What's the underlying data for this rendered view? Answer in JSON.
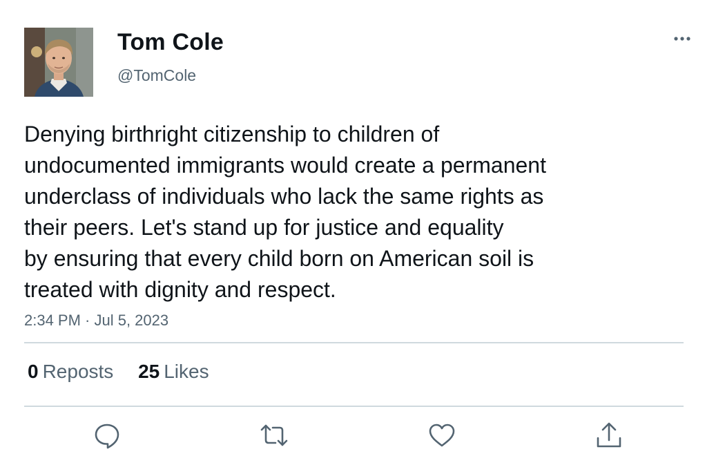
{
  "author": {
    "name": "Tom Cole",
    "handle": "@TomCole",
    "avatar_icon": "profile-photo"
  },
  "tweet": {
    "text": "Denying birthright citizenship to children of\nundocumented immigrants would create a permanent\nunderclass of individuals who lack the same rights as\ntheir peers. Let's stand up for justice and equality\nby ensuring that every child born on American soil is\ntreated with dignity and respect.",
    "timestamp": "2:34 PM · Jul 5, 2023"
  },
  "stats": {
    "reposts_count": "0",
    "reposts_label": "Reposts",
    "likes_count": "25",
    "likes_label": "Likes"
  },
  "actions": [
    {
      "name": "reply",
      "icon": "speech-bubble-icon"
    },
    {
      "name": "repost",
      "icon": "repost-arrows-icon"
    },
    {
      "name": "like",
      "icon": "heart-icon"
    },
    {
      "name": "share",
      "icon": "share-upload-icon"
    }
  ],
  "colors": {
    "text_primary": "#0f1419",
    "text_secondary": "#536471",
    "divider": "#cfd9de",
    "icon": "#536471"
  }
}
